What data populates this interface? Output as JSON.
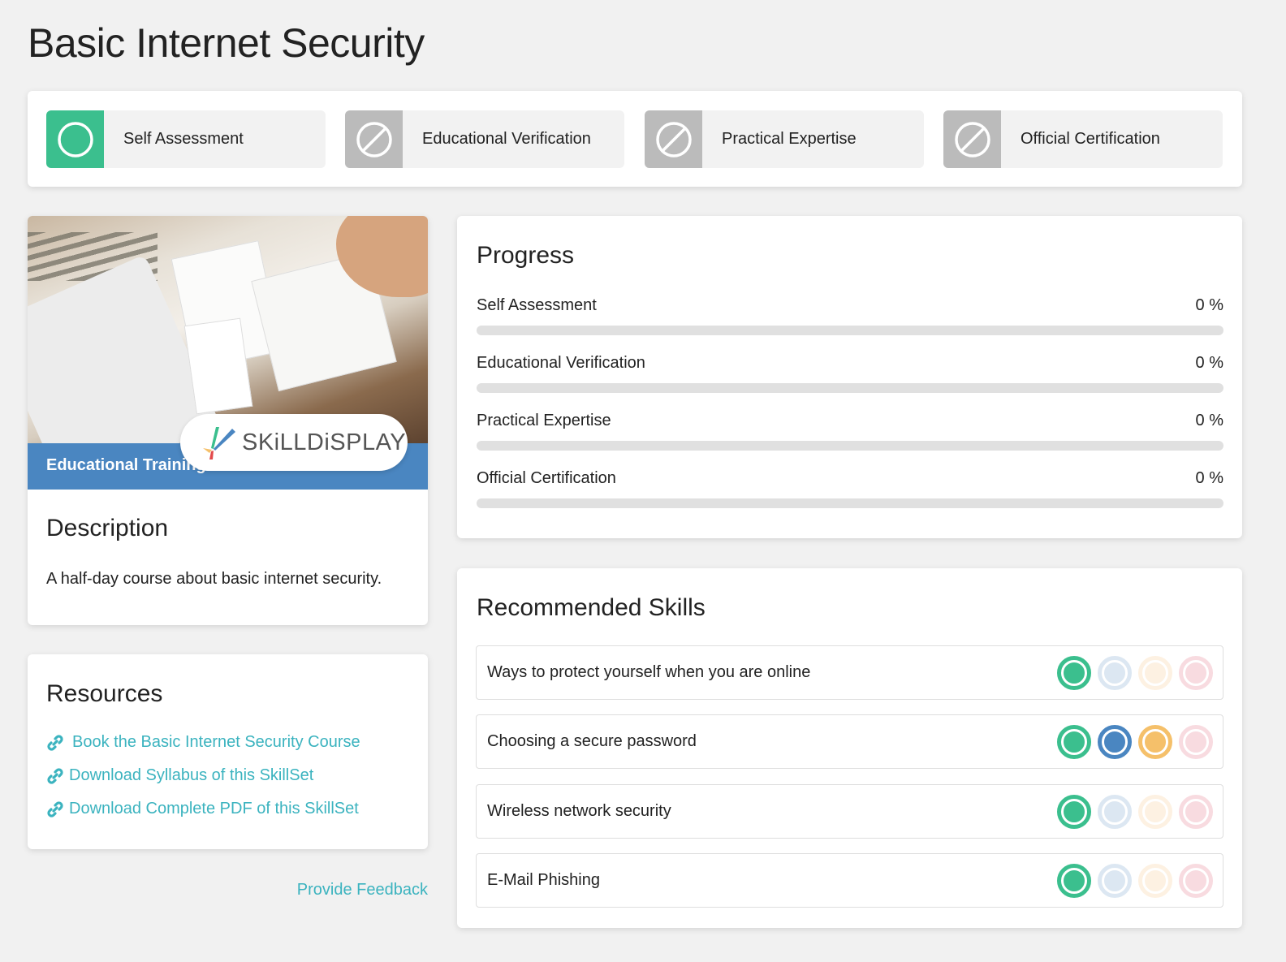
{
  "page": {
    "title": "Basic Internet Security"
  },
  "levels": [
    {
      "label": "Self Assessment",
      "state": "active",
      "icon": "circle-icon"
    },
    {
      "label": "Educational Verification",
      "state": "inactive",
      "icon": "prohibited-icon"
    },
    {
      "label": "Practical Expertise",
      "state": "inactive",
      "icon": "prohibited-icon"
    },
    {
      "label": "Official Certification",
      "state": "inactive",
      "icon": "prohibited-icon"
    }
  ],
  "course": {
    "band_label": "Educational Training",
    "logo_text": "SKiLLDiSPLAY",
    "description_heading": "Description",
    "description_text": "A half-day course about basic internet security."
  },
  "resources": {
    "heading": "Resources",
    "links": [
      {
        "label": "Book the Basic Internet Security Course",
        "icon": "link-icon"
      },
      {
        "label": "Download Syllabus of this SkillSet",
        "icon": "link-icon"
      },
      {
        "label": "Download Complete PDF of this SkillSet",
        "icon": "link-icon"
      }
    ],
    "feedback_label": "Provide Feedback"
  },
  "progress": {
    "heading": "Progress",
    "items": [
      {
        "label": "Self Assessment",
        "value_text": "0 %",
        "percent": 0
      },
      {
        "label": "Educational Verification",
        "value_text": "0 %",
        "percent": 0
      },
      {
        "label": "Practical Expertise",
        "value_text": "0 %",
        "percent": 0
      },
      {
        "label": "Official Certification",
        "value_text": "0 %",
        "percent": 0
      }
    ]
  },
  "skills": {
    "heading": "Recommended Skills",
    "level_colors": {
      "self": {
        "on": "#3bbf8e",
        "off": "#dce7f2"
      },
      "education": {
        "on": "#4a86c1",
        "off": "#dce7f2"
      },
      "practical": {
        "on": "#f5c06a",
        "off": "#fdf1e2"
      },
      "certification": {
        "on": "#f3a6b3",
        "off": "#f8dbe0"
      }
    },
    "items": [
      {
        "label": "Ways to protect yourself when you are online",
        "levels": [
          true,
          false,
          false,
          false
        ]
      },
      {
        "label": "Choosing a secure password",
        "levels": [
          true,
          true,
          true,
          false
        ]
      },
      {
        "label": "Wireless network security",
        "levels": [
          true,
          false,
          false,
          false
        ]
      },
      {
        "label": "E-Mail Phishing",
        "levels": [
          true,
          false,
          false,
          false
        ]
      }
    ]
  }
}
